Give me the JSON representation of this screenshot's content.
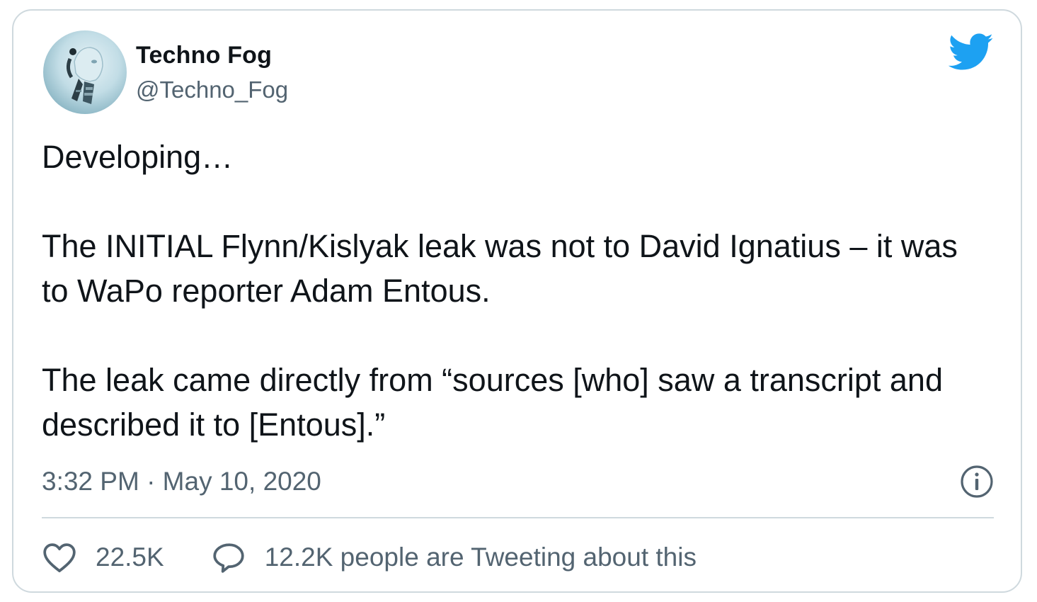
{
  "tweet": {
    "display_name": "Techno Fog",
    "handle": "@Techno_Fog",
    "text": "Developing…\n\nThe INITIAL Flynn/Kislyak leak was not to David Ignatius – it was to WaPo reporter Adam Entous.\n\nThe leak came directly from “sources [who] saw a transcript and described it to [Entous].”",
    "timestamp": "3:32 PM · May 10, 2020"
  },
  "footer": {
    "likes_count": "22.5K",
    "replies_text": "12.2K people are Tweeting about this"
  },
  "icons": {
    "logo": "twitter-bird-icon",
    "info": "info-icon",
    "like": "heart-icon",
    "reply": "speech-bubble-icon"
  },
  "colors": {
    "brand_blue": "#1da1f2",
    "text_primary": "#0f1419",
    "text_secondary": "#536471",
    "border": "#cfd9de"
  }
}
